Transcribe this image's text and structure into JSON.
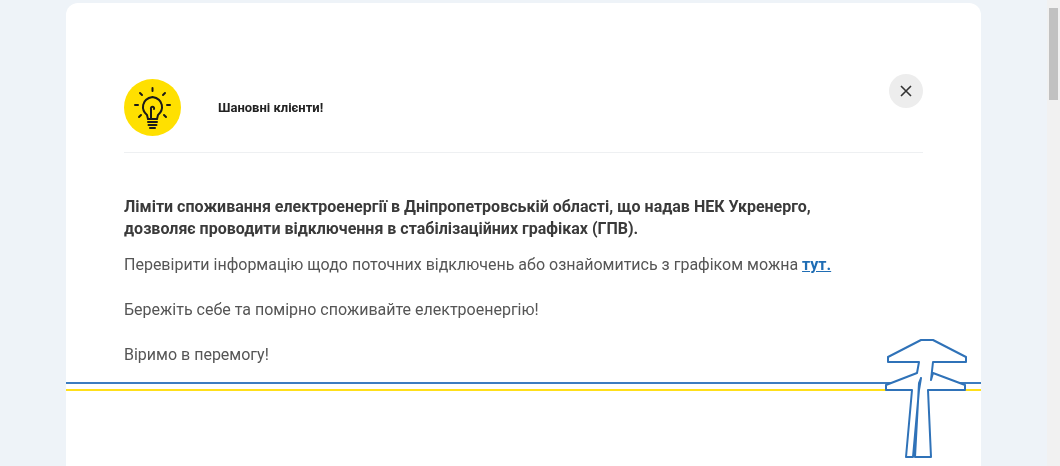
{
  "dialog": {
    "title": "Шановні клієнти!",
    "lead": "Ліміти споживання електроенергії в Дніпропетровській області, що надав НЕК Укренерго, дозволяє проводити відключення в стабілізаційних графіках (ГПВ).",
    "info_text": "Перевірити інформацію щодо поточних відключень або ознайомитись з графіком можна",
    "info_link": "тут.",
    "care_text": "Бережіть себе та помірно споживайте електроенергію!",
    "closing": "Віримо в перемогу!"
  }
}
